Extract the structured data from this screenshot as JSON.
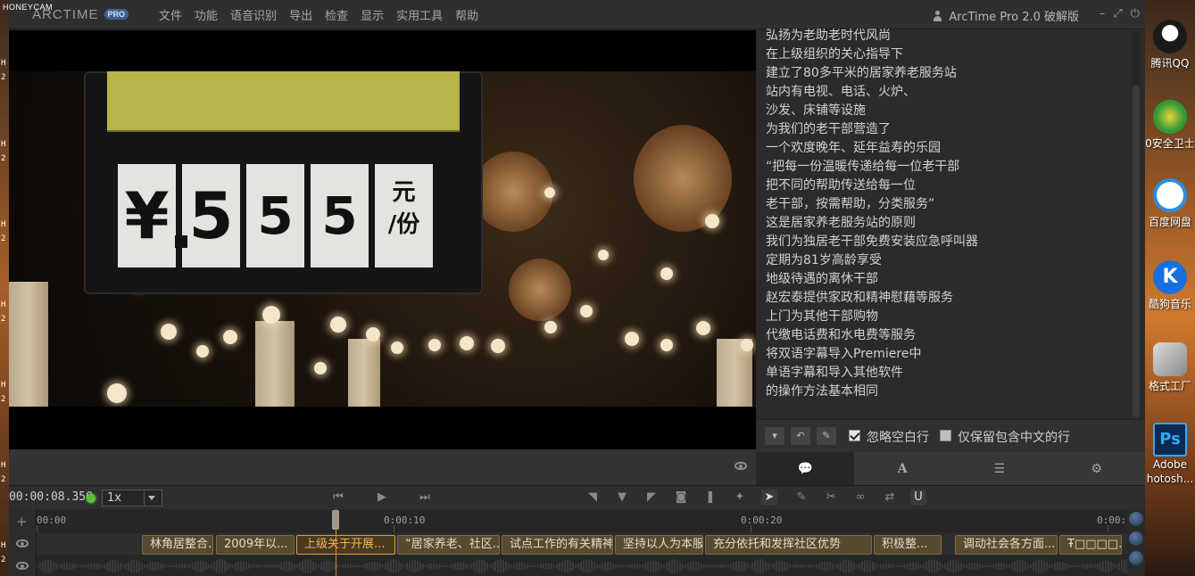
{
  "watermark": "HONEYCAM",
  "app": {
    "logo_text": "ARCTIME",
    "logo_badge": "PRO",
    "window_title": "ArcTime Pro 2.0 破解版",
    "menu": [
      "文件",
      "功能",
      "语音识别",
      "导出",
      "检查",
      "显示",
      "实用工具",
      "帮助"
    ]
  },
  "video": {
    "price_cards": [
      "¥",
      "5",
      "5",
      "5"
    ],
    "unit_top": "元",
    "unit_bottom": "/份"
  },
  "subtitle_lines": [
    "弘扬为老助老时代风尚",
    "在上级组织的关心指导下",
    "建立了80多平米的居家养老服务站",
    "站内有电视、电话、火炉、",
    "沙发、床铺等设施",
    "为我们的老干部营造了",
    "一个欢度晚年、延年益寿的乐园",
    "“把每一份温暖传递给每一位老干部",
    "把不同的帮助传送给每一位",
    "老干部，按需帮助，分类服务”",
    "这是居家养老服务站的原则",
    "我们为独居老干部免费安装应急呼叫器",
    "定期为81岁高龄享受",
    "地级待遇的离休干部",
    "赵宏泰提供家政和精神慰藉等服务",
    "上门为其他干部购物",
    "代缴电话费和水电费等服务",
    "将双语字幕导入Premiere中",
    "单语字幕和导入其他软件",
    "的操作方法基本相同"
  ],
  "text_options": {
    "ignore_blank": "忽略空白行",
    "keep_chinese": "仅保留包含中文的行"
  },
  "transport": {
    "timecode": "00:00:08.350",
    "speed": "1x"
  },
  "timeline": {
    "ruler": [
      "00:00",
      "0:00:10",
      "0:00:20",
      "0:00:"
    ],
    "clips": [
      "林角居整合...",
      "2009年以...",
      "上级关于开展...",
      "“居家养老、社区...",
      "试点工作的有关精神",
      "坚持以人为本服务",
      "充分依托和发挥社区优势",
      "积极整...",
      "调动社会各方面...",
      "Ŧ□□□□."
    ]
  },
  "desktop_icons": [
    {
      "label": "腾讯QQ",
      "color": "#1a1a1a"
    },
    {
      "label": "0安全卫士",
      "color": "#2e9a36"
    },
    {
      "label": "百度网盘",
      "color": "#2a8ee8"
    },
    {
      "label": "酷狗音乐",
      "color": "#1b6ee0"
    },
    {
      "label": "格式工厂",
      "color": "#6a6a6a"
    },
    {
      "label": "Adobe",
      "color": "#0a2a52"
    }
  ],
  "desktop_icon_extra": "hotosh...",
  "left_strip_chars": [
    "H",
    "2",
    "H",
    "2",
    "H",
    "2",
    "H",
    "2",
    "H",
    "2",
    "H",
    "2",
    "H",
    "2"
  ]
}
